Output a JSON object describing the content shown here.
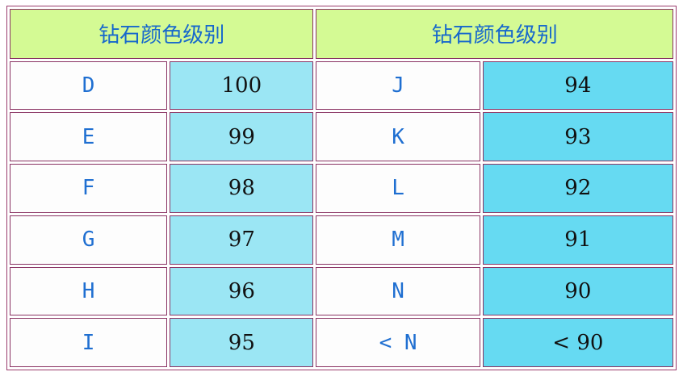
{
  "headers": [
    "钻石颜色级别",
    "钻石颜色级别"
  ],
  "left_rows": [
    {
      "grade": "D",
      "value": "100"
    },
    {
      "grade": "E",
      "value": "99"
    },
    {
      "grade": "F",
      "value": "98"
    },
    {
      "grade": "G",
      "value": "97"
    },
    {
      "grade": "H",
      "value": "96"
    },
    {
      "grade": "I",
      "value": "95"
    }
  ],
  "right_rows": [
    {
      "grade": "J",
      "value": "94"
    },
    {
      "grade": "K",
      "value": "93"
    },
    {
      "grade": "L",
      "value": "92"
    },
    {
      "grade": "M",
      "value": "91"
    },
    {
      "grade": "N",
      "value": "90"
    },
    {
      "grade": "< N",
      "value": "< 90"
    }
  ],
  "colors": {
    "header_bg": "#d4fa94",
    "header_text": "#1768cc",
    "grade_text": "#1f6fd1",
    "left_value_bg": "#9be6f4",
    "right_value_bg": "#66daf2",
    "border": "#8a3363"
  }
}
